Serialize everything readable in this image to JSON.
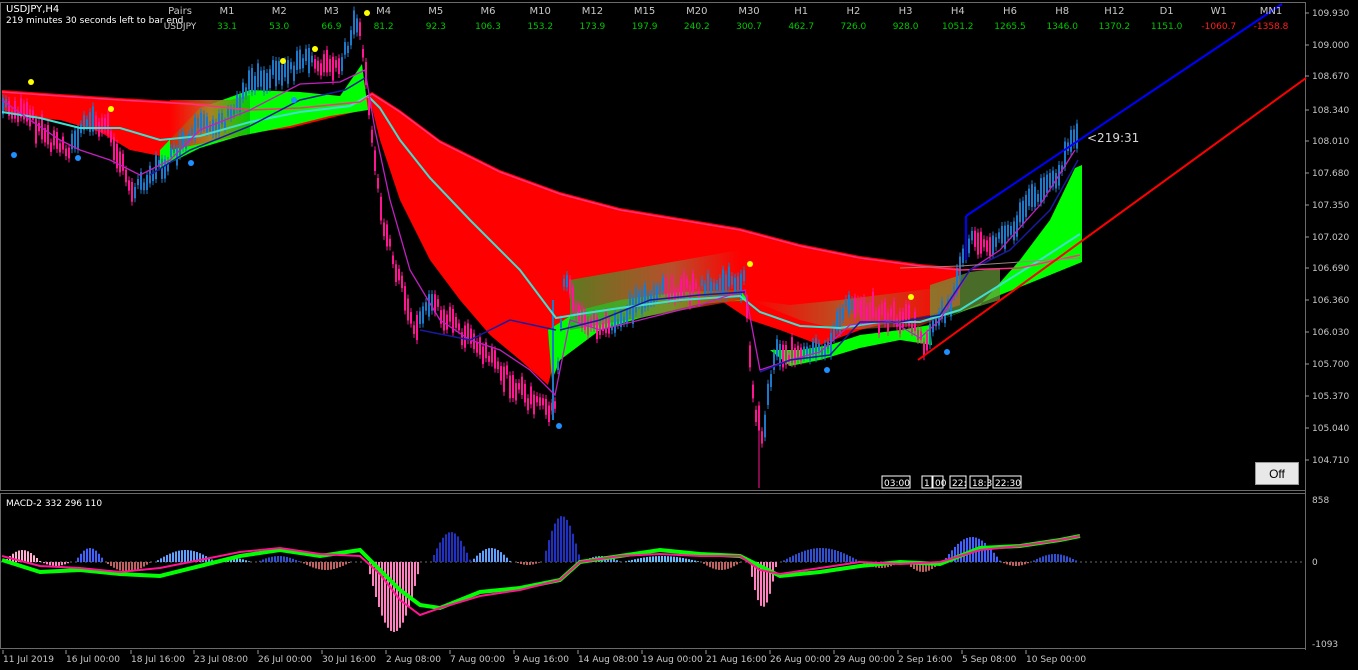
{
  "window": {
    "title": "USDJPY,H4",
    "timer_text": "219 minutes 30 seconds left to bar end"
  },
  "strength_panel": {
    "pairs_label": "Pairs",
    "symbol": "USDJPY",
    "timeframes": [
      "M1",
      "M2",
      "M3",
      "M4",
      "M5",
      "M6",
      "M10",
      "M12",
      "M15",
      "M20",
      "M30",
      "H1",
      "H2",
      "H3",
      "H4",
      "H6",
      "H8",
      "H12",
      "D1",
      "W1",
      "MN1"
    ],
    "values": [
      "33.1",
      "53.0",
      "66.9",
      "81.2",
      "92.3",
      "106.3",
      "153.2",
      "173.9",
      "197.9",
      "240.2",
      "300.7",
      "462.7",
      "726.0",
      "928.0",
      "1051.2",
      "1265.5",
      "1346.0",
      "1370.2",
      "1151.0",
      "-1060.7",
      "-1358.8"
    ],
    "positive_color": "#00c800",
    "negative_color": "#ff2020"
  },
  "countdown_label": "<219:31",
  "off_button_label": "Off",
  "price_axis": [
    "109.930",
    "109.000",
    "108.670",
    "108.340",
    "108.010",
    "107.680",
    "107.350",
    "107.020",
    "106.690",
    "106.360",
    "106.030",
    "105.700",
    "105.370",
    "105.040",
    "104.710"
  ],
  "time_axis": [
    "11 Jul 2019",
    "16 Jul 00:00",
    "18 Jul 16:00",
    "23 Jul 08:00",
    "26 Jul 00:00",
    "30 Jul 16:00",
    "2 Aug 08:00",
    "7 Aug 00:00",
    "9 Aug 16:00",
    "14 Aug 08:00",
    "19 Aug 00:00",
    "21 Aug 16:00",
    "26 Aug 00:00",
    "29 Aug 00:00",
    "2 Sep 16:00",
    "5 Sep 08:00",
    "10 Sep 00:00"
  ],
  "session_boxes": [
    "03:00",
    "1",
    "00",
    "22:",
    "18:3",
    "22:30"
  ],
  "macd": {
    "title": "MACD-2 332 296 110",
    "axis": [
      "858",
      "0",
      "-1093"
    ]
  },
  "colors": {
    "bull": "#00ff00",
    "bear": "#ff0000",
    "ma_cyan": "#40e0d0",
    "channel_blue": "#0000ff",
    "trend_red": "#ff0000",
    "candle_blue": "#1e78c8",
    "candle_pink": "#ff1493"
  }
}
